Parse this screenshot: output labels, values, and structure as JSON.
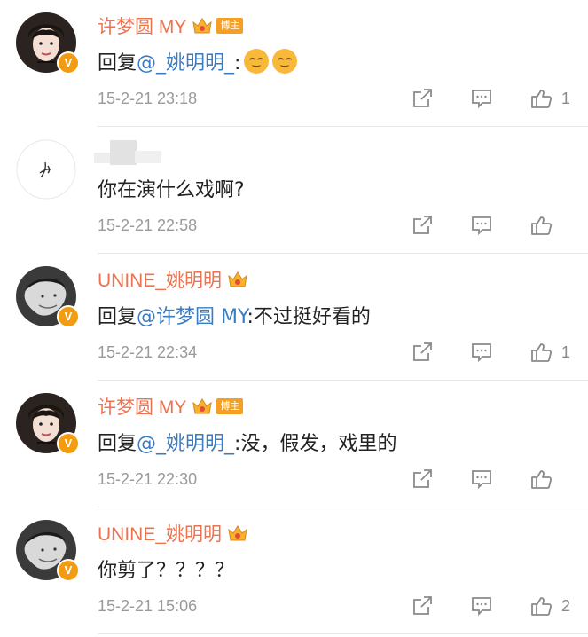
{
  "comments": [
    {
      "avatar": "girl-avatar",
      "username": "许梦圆 MY",
      "has_crown": true,
      "tag": "博主",
      "reply_prefix": "回复",
      "mention": "@_姚明明_",
      "text": ":",
      "emoji_count": 2,
      "timestamp": "15-2-21 23:18",
      "likes": "1"
    },
    {
      "avatar": "signature-avatar",
      "username": "",
      "has_crown": false,
      "tag": "",
      "reply_prefix": "",
      "mention": "",
      "text": "你在演什么戏啊?",
      "emoji_count": 0,
      "timestamp": "15-2-21 22:58",
      "likes": ""
    },
    {
      "avatar": "boy-avatar",
      "username": "UNINE_姚明明",
      "has_crown": true,
      "tag": "",
      "reply_prefix": "回复",
      "mention": "@许梦圆 MY",
      "text": ":不过挺好看的",
      "emoji_count": 0,
      "timestamp": "15-2-21 22:34",
      "likes": "1"
    },
    {
      "avatar": "girl-avatar",
      "username": "许梦圆 MY",
      "has_crown": true,
      "tag": "博主",
      "reply_prefix": "回复",
      "mention": "@_姚明明_",
      "text": ":没，假发，戏里的",
      "emoji_count": 0,
      "timestamp": "15-2-21 22:30",
      "likes": ""
    },
    {
      "avatar": "boy-avatar",
      "username": "UNINE_姚明明",
      "has_crown": true,
      "tag": "",
      "reply_prefix": "",
      "mention": "",
      "text": "你剪了？？？？",
      "emoji_count": 0,
      "timestamp": "15-2-21 15:06",
      "likes": "2"
    }
  ],
  "colors": {
    "username": "#eb7350",
    "mention": "#3b7bbf",
    "timestamp": "#9a9a9a",
    "badge": "#f39c12",
    "tag_bg": "#f6a023"
  },
  "icons": {
    "share": "share-icon",
    "comment": "comment-icon",
    "like": "thumbs-up-icon",
    "verified": "verified-v-badge",
    "crown": "crown-icon"
  }
}
